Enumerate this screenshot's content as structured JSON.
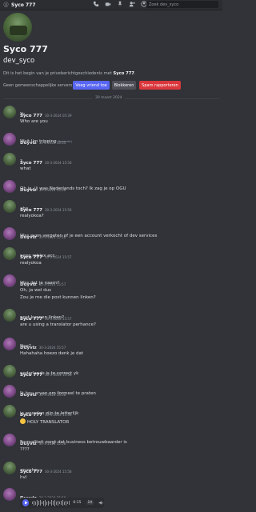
{
  "topbar": {
    "username": "Syco 777",
    "search_placeholder": "Zoek dev_syco"
  },
  "profile": {
    "display_name": "Syco 777",
    "handle": "dev_syco",
    "intro_prefix": "Dit is het begin van je priveberichtgeschiedenis met ",
    "intro_name": "Syco 777",
    "intro_suffix": ".",
    "mutual_servers": "Geen gemeenschappelijke servers",
    "add_friend_label": "Voeg vriend toe",
    "block_label": "Blokkeren",
    "report_spam_label": "Spam rapporteren"
  },
  "date_divider": "30 maart 2024",
  "messages": [
    {
      "author": "Syco 777",
      "time": "30-3-2024 05:39",
      "lines": [
        "Yo",
        "Who are you"
      ]
    },
    {
      "author": "Duyvlz",
      "time": "30-3-2024 15:55",
      "lines": [
        "Wait I'm tripping"
      ],
      "edited": "(bewerkt)"
    },
    {
      "author": "Syco 777",
      "time": "30-3-2024 15:56",
      "lines": [
        "?",
        "what"
      ]
    },
    {
      "author": "Duyvlz",
      "time": "30-3-2024 15:56",
      "lines": [
        "Oh ja, jij was Nederlands toch? Ik zag je op OGU"
      ]
    },
    {
      "author": "Syco 777",
      "time": "30-3-2024 15:56",
      "lines": [
        "aha",
        "realyokoa?"
      ]
    },
    {
      "author": "Duyvlz",
      "time": "30-3-2024 15:56",
      "lines": [
        "Was even vergeten of je een account verkocht of dev services"
      ]
    },
    {
      "author": "Syco 777",
      "time": "30-3-2024 15:57",
      "lines": [
        "neee roblox acc",
        "realyokoa"
      ]
    },
    {
      "author": "Duyvlz",
      "time": "30-3-2024 15:57",
      "lines": [
        "Was dat je naam?",
        "Oh, ja wel dus",
        "Zou je me die post kunnen linken?"
      ]
    },
    {
      "author": "Syco 777",
      "time": "30-3-2024 15:57",
      "lines": [
        "post kunnen linken?",
        "are u using a translator perhance?"
      ]
    },
    {
      "author": "Duyvlz",
      "time": "30-3-2024 15:57",
      "lines": [
        "Nee?",
        "Hahahaha hoezo denk je dat"
      ]
    },
    {
      "author": "Syco 777",
      "time": "30-3-2024 15:58",
      "lines": [
        "nederlands is te correct yk"
      ]
    },
    {
      "author": "Duyvlz",
      "time": "30-3-2024 15:58",
      "lines": [
        "Ik hou ervan om formeel te praten"
      ]
    },
    {
      "author": "Syco 777",
      "time": "30-3-2024 15:58",
      "lines": [
        "je woorden zijn te letterlijk",
        "HOLY TRANSLATOR"
      ]
    },
    {
      "author": "Duyvlz",
      "time": "30-3-2024 15:58",
      "lines": [
        "Formaliteit zorgt dat business betrouwbaarder is",
        "????"
      ]
    },
    {
      "author": "Syco 777",
      "time": "30-3-2024 15:58",
      "lines": [
        "anywho",
        "hvl"
      ]
    },
    {
      "author": "Duyvlz",
      "time": "30-3-2024 15:59",
      "lines": []
    }
  ],
  "audio": {
    "time": "0:15",
    "speed": "1X"
  }
}
